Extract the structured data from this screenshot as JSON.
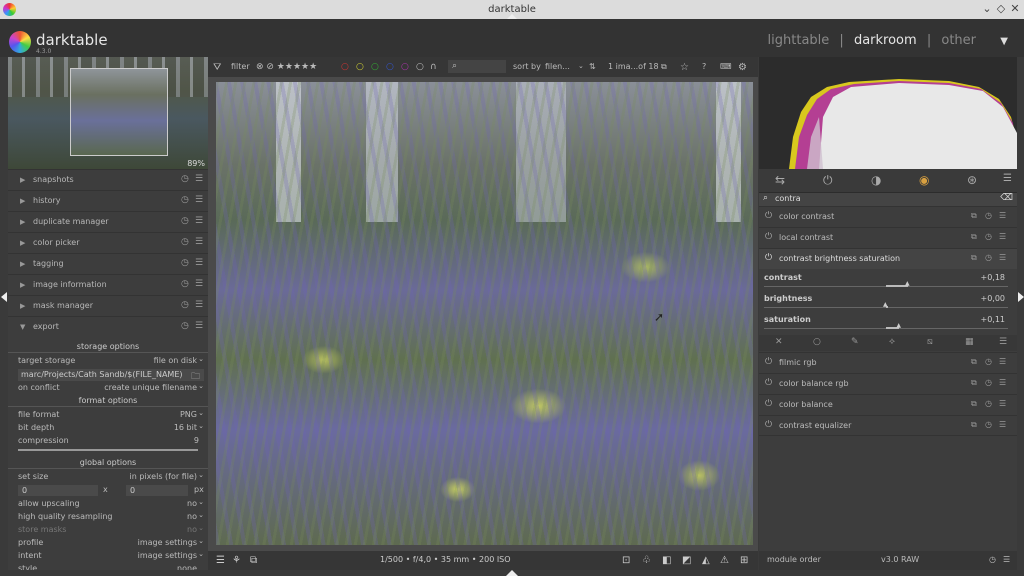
{
  "window": {
    "title": "darktable",
    "controls": [
      "⌄",
      "◇",
      "✕"
    ]
  },
  "header": {
    "app_name": "darktable",
    "version": "4.3.0",
    "views": [
      "lighttable",
      "darkroom",
      "other"
    ],
    "separator": "|",
    "active_view": "darkroom",
    "menu_icon": "▼"
  },
  "left": {
    "navigation_zoom": "89%",
    "modules": [
      {
        "label": "snapshots",
        "expanded": false
      },
      {
        "label": "history",
        "expanded": false
      },
      {
        "label": "duplicate manager",
        "expanded": false
      },
      {
        "label": "color picker",
        "expanded": false
      },
      {
        "label": "tagging",
        "expanded": false
      },
      {
        "label": "image information",
        "expanded": false
      },
      {
        "label": "mask manager",
        "expanded": false
      },
      {
        "label": "export",
        "expanded": true
      }
    ],
    "export": {
      "storage_options_title": "storage options",
      "target_storage_label": "target storage",
      "target_storage_value": "file on disk",
      "path": "marc/Projects/Cath Sandb/$(FILE_NAME)",
      "on_conflict_label": "on conflict",
      "on_conflict_value": "create unique filename",
      "format_options_title": "format options",
      "file_format_label": "file format",
      "file_format_value": "PNG",
      "bit_depth_label": "bit depth",
      "bit_depth_value": "16 bit",
      "compression_label": "compression",
      "compression_value": "9",
      "global_options_title": "global options",
      "set_size_label": "set size",
      "set_size_value": "in pixels (for file)",
      "width_value": "0",
      "height_value": "0",
      "size_sep": "x",
      "size_unit": "px",
      "allow_upscaling_label": "allow upscaling",
      "allow_upscaling_value": "no",
      "hq_resampling_label": "high quality resampling",
      "hq_resampling_value": "no",
      "store_masks_label": "store masks",
      "store_masks_value": "no",
      "profile_label": "profile",
      "profile_value": "image settings",
      "intent_label": "intent",
      "intent_value": "image settings",
      "style_label": "style",
      "style_value": "none"
    }
  },
  "top_toolbar": {
    "filter_label": "filter",
    "sort_label": "sort by",
    "sort_value": "filen...",
    "count": "1 ima...of 18"
  },
  "bottom_toolbar": {
    "exif": "1/500 • f/4,0 • 35 mm • 200 ISO"
  },
  "right": {
    "search_value": "contra",
    "modules_top": [
      {
        "label": "color contrast"
      },
      {
        "label": "local contrast"
      },
      {
        "label": "contrast brightness saturation"
      }
    ],
    "sliders": [
      {
        "label": "contrast",
        "value": "+0,18",
        "fraction": 0.59
      },
      {
        "label": "brightness",
        "value": "+0,00",
        "fraction": 0.5
      },
      {
        "label": "saturation",
        "value": "+0,11",
        "fraction": 0.555
      }
    ],
    "modules_bottom": [
      {
        "label": "filmic rgb"
      },
      {
        "label": "color balance rgb"
      },
      {
        "label": "color balance"
      },
      {
        "label": "contrast equalizer"
      }
    ],
    "module_order_label": "module order",
    "module_order_value": "v3.0 RAW"
  },
  "colors": {
    "accent_active": "#e6e6e6",
    "panel_bg": "#3d3d3d",
    "histogram_yellow": "#d8c81e",
    "histogram_magenta": "#b030a0"
  }
}
